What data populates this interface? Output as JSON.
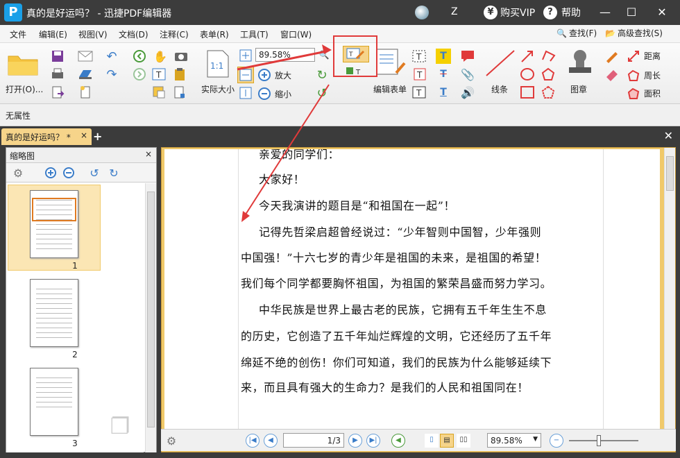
{
  "window": {
    "title": "真的是好运吗？ - 迅捷PDF编辑器",
    "user": "Z",
    "vip": "购买VIP",
    "help": "帮助",
    "logo": "P"
  },
  "menu": [
    "文件",
    "编辑(E)",
    "视图(V)",
    "文档(D)",
    "注释(C)",
    "表单(R)",
    "工具(T)",
    "窗口(W)"
  ],
  "search": {
    "find": "查找(F)",
    "advanced": "高级查找(S)"
  },
  "ribbon": {
    "open": "打开(O)...",
    "actual_size": "实际大小",
    "actual_icon": "1:1",
    "zoom_value": "89.58%",
    "zoom_in": "放大",
    "zoom_out": "缩小",
    "edit_form": "编辑表单",
    "line": "线条",
    "stamp": "图章",
    "distance": "距离",
    "perimeter": "周长",
    "area": "面积"
  },
  "properties": "无属性",
  "tab": {
    "label": "真的是好运吗？ *",
    "close": "×"
  },
  "thumbnails": {
    "title": "缩略图",
    "close": "×",
    "pages": [
      "1",
      "2",
      "3"
    ]
  },
  "document": {
    "lines": [
      "亲爱的同学们：",
      "大家好！",
      "今天我演讲的题目是“和祖国在一起”！",
      "记得先哲梁启超曾经说过：“少年智则中国智，少年强则",
      "中国强！”十六七岁的青少年是祖国的未来，是祖国的希望！",
      "我们每个同学都要胸怀祖国，为祖国的繁荣昌盛而努力学习。",
      "中华民族是世界上最古老的民族，它拥有五千年生生不息",
      "的历史，它创造了五千年灿烂辉煌的文明，它还经历了五千年",
      "绵延不绝的创伤！你们可知道，我们的民族为什么能够延续下",
      "来，而且具有强大的生命力？是我们的人民和祖国同在！"
    ]
  },
  "statusbar": {
    "page": "1",
    "page_total": "/3",
    "zoom": "89.58%"
  }
}
